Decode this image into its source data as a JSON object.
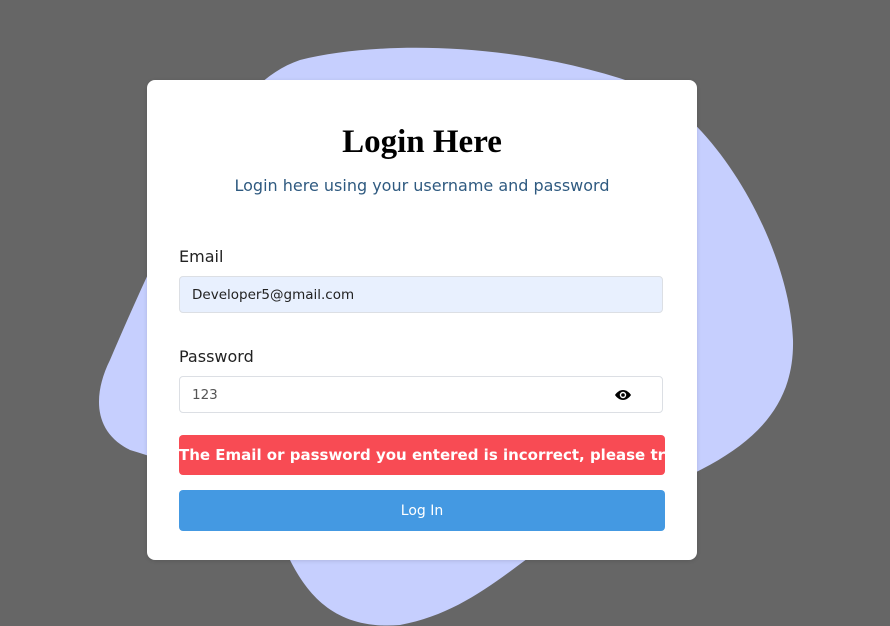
{
  "page": {
    "background": "#666666",
    "blob_color": "#c6cffe"
  },
  "login": {
    "title": "Login Here",
    "subtitle": "Login here using your username and password",
    "email_label": "Email",
    "email_value": "Developer5@gmail.com",
    "password_label": "Password",
    "password_value": "123",
    "show_password_icon": "eye-icon",
    "error_message": "The Email or password you entered is incorrect, please try again.",
    "login_button": "Log In"
  },
  "colors": {
    "title": "#000000",
    "subtitle": "#2f5a80",
    "error_bg": "#f84b54",
    "button_bg": "#4499e2",
    "autofill_bg": "#e8f0fe"
  }
}
